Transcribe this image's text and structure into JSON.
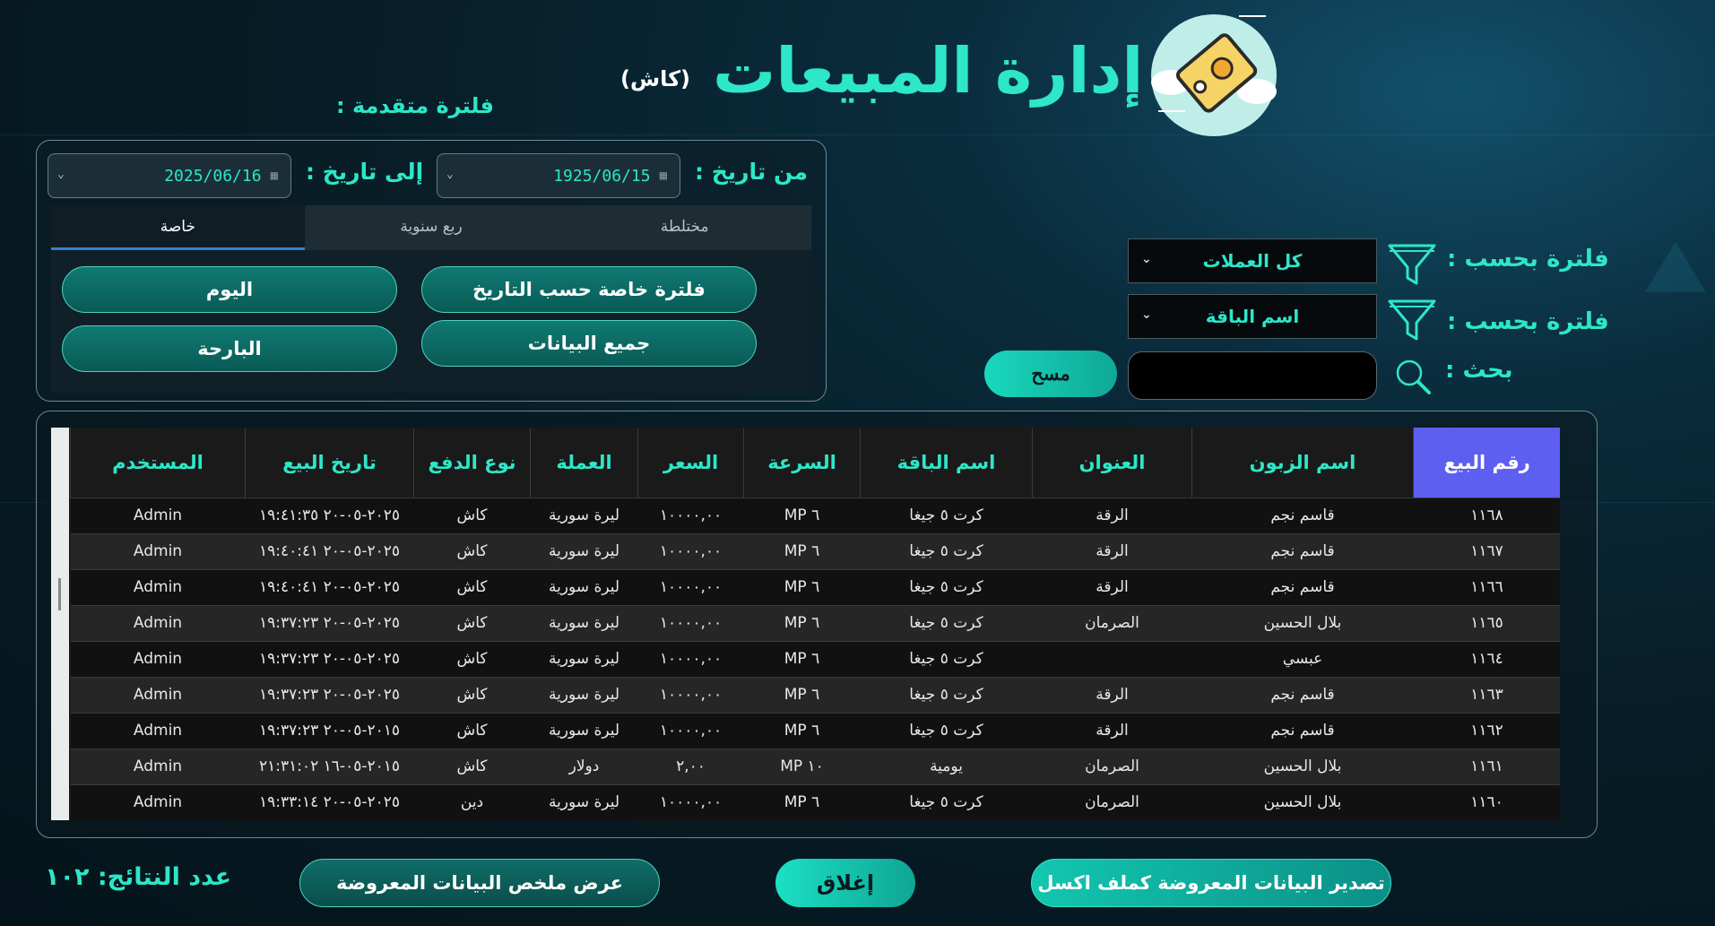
{
  "header": {
    "title": "إدارة المبيعات",
    "subtitle": "(كاش)",
    "advanced_filter_label": "فلترة متقدمة :"
  },
  "advanced_filter": {
    "from_label": "من تاريخ :",
    "from_value": "1925/06/15",
    "to_label": "إلى تاريخ :",
    "to_value": "2025/06/16",
    "tabs": [
      "مختلطة",
      "ربع سنوية",
      "خاصة"
    ],
    "active_tab": "خاصة",
    "buttons": {
      "date_filter": "فلترة خاصة حسب التاريخ",
      "today": "اليوم",
      "all_data": "جميع البيانات",
      "yesterday": "البارحة"
    }
  },
  "filters": {
    "filter_by_label": "فلترة بحسب :",
    "currency_selected": "كل العملات",
    "package_selected": "اسم الباقة",
    "search_label": "بحث :",
    "search_value": "",
    "clear_button": "مسح"
  },
  "table": {
    "headers": [
      "رقم البيع",
      "اسم الزبون",
      "العنوان",
      "اسم الباقة",
      "السرعة",
      "السعر",
      "العملة",
      "نوع الدفع",
      "تاريخ البيع",
      "المستخدم"
    ],
    "rows": [
      [
        "١١٦٨",
        "قاسم نجم",
        "الرقة",
        "كرت ٥ جيغا",
        "٦ MP",
        "١٠٠٠٠,٠٠",
        "ليرة سورية",
        "كاش",
        "٢٠٢٥-٠٥-٢٠ ١٩:٤١:٣٥",
        "Admin"
      ],
      [
        "١١٦٧",
        "قاسم نجم",
        "الرقة",
        "كرت ٥ جيغا",
        "٦ MP",
        "١٠٠٠٠,٠٠",
        "ليرة سورية",
        "كاش",
        "٢٠٢٥-٠٥-٢٠ ١٩:٤٠:٤١",
        "Admin"
      ],
      [
        "١١٦٦",
        "قاسم نجم",
        "الرقة",
        "كرت ٥ جيغا",
        "٦ MP",
        "١٠٠٠٠,٠٠",
        "ليرة سورية",
        "كاش",
        "٢٠٢٥-٠٥-٢٠ ١٩:٤٠:٤١",
        "Admin"
      ],
      [
        "١١٦٥",
        "بلال الحسين",
        "الصرمان",
        "كرت ٥ جيغا",
        "٦ MP",
        "١٠٠٠٠,٠٠",
        "ليرة سورية",
        "كاش",
        "٢٠٢٥-٠٥-٢٠ ١٩:٣٧:٢٣",
        "Admin"
      ],
      [
        "١١٦٤",
        "عبسي",
        "",
        "كرت ٥ جيغا",
        "٦ MP",
        "١٠٠٠٠,٠٠",
        "ليرة سورية",
        "كاش",
        "٢٠٢٥-٠٥-٢٠ ١٩:٣٧:٢٣",
        "Admin"
      ],
      [
        "١١٦٣",
        "قاسم نجم",
        "الرقة",
        "كرت ٥ جيغا",
        "٦ MP",
        "١٠٠٠٠,٠٠",
        "ليرة سورية",
        "كاش",
        "٢٠٢٥-٠٥-٢٠ ١٩:٣٧:٢٣",
        "Admin"
      ],
      [
        "١١٦٢",
        "قاسم نجم",
        "الرقة",
        "كرت ٥ جيغا",
        "٦ MP",
        "١٠٠٠٠,٠٠",
        "ليرة سورية",
        "كاش",
        "٢٠١٥-٠٥-٢٠ ١٩:٣٧:٢٣",
        "Admin"
      ],
      [
        "١١٦١",
        "بلال الحسين",
        "الصرمان",
        "يومية",
        "١٠ MP",
        "٢,٠٠",
        "دولار",
        "كاش",
        "٢٠١٥-٠٥-١٦ ٢١:٣١:٠٢",
        "Admin"
      ],
      [
        "١١٦٠",
        "بلال الحسين",
        "الصرمان",
        "كرت ٥ جيغا",
        "٦ MP",
        "١٠٠٠٠,٠٠",
        "ليرة سورية",
        "دين",
        "٢٠٢٥-٠٥-٢٠ ١٩:٣٣:١٤",
        "Admin"
      ]
    ]
  },
  "footer": {
    "export_button": "تصدير البيانات المعروضة كملف اكسل",
    "close_button": "إغلاق",
    "summary_button": "عرض ملخص البيانات المعروضة",
    "results_count": "عدد النتائج: ١٠٢"
  },
  "colors": {
    "accent": "#2ee6c8",
    "selected_header": "#5c5ff0",
    "background": "#071c26"
  },
  "icons": [
    "tag-logo-icon",
    "calendar-icon",
    "chevron-down-icon",
    "funnel-icon",
    "search-icon"
  ]
}
